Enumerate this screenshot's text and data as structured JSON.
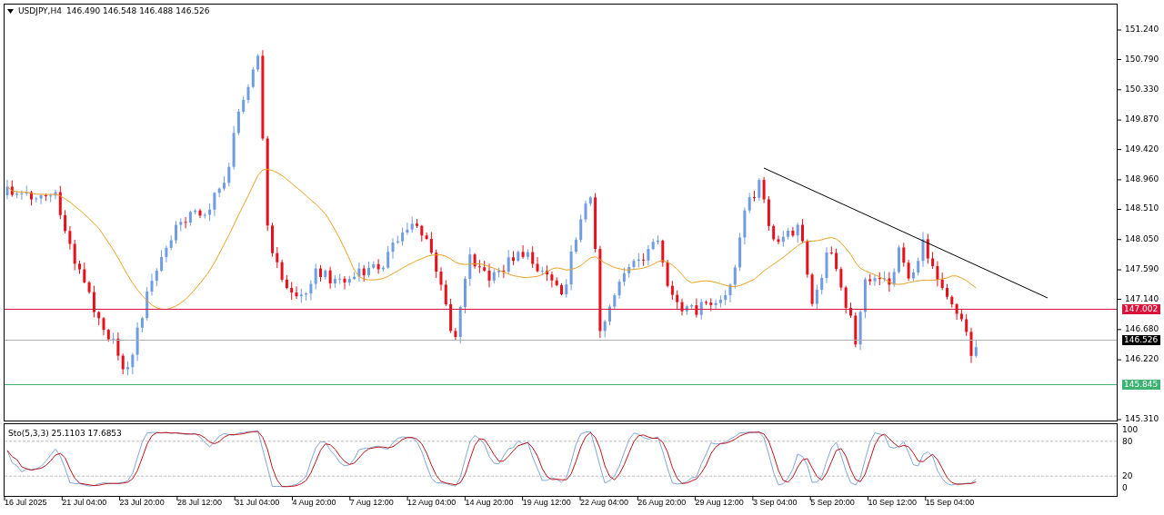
{
  "chart_header": {
    "symbol": "USDJPY,H4",
    "quotes": "146.490 146.548 146.488 146.526"
  },
  "price_axis": {
    "ticks": [
      "151.240",
      "150.790",
      "150.330",
      "149.870",
      "149.420",
      "148.960",
      "148.510",
      "148.050",
      "147.590",
      "147.140",
      "146.680",
      "146.220",
      "145.310"
    ]
  },
  "price_markers": [
    {
      "kind": "resistance",
      "label": "147.002",
      "color": "#dc143c"
    },
    {
      "kind": "current",
      "label": "146.526",
      "color": "#000000"
    },
    {
      "kind": "support",
      "label": "145.845",
      "color": "#3cb371"
    }
  ],
  "indicator": {
    "label": "Sto(5,3,3) 25.1103 17.6853",
    "levels": [
      "100",
      "80",
      "20",
      "0"
    ]
  },
  "time_axis": {
    "labels": [
      "16 Jul 2025",
      "21 Jul 04:00",
      "23 Jul 20:00",
      "28 Jul 12:00",
      "31 Jul 04:00",
      "4 Aug 20:00",
      "7 Aug 12:00",
      "12 Aug 04:00",
      "14 Aug 20:00",
      "19 Aug 12:00",
      "22 Aug 04:00",
      "26 Aug 20:00",
      "29 Aug 12:00",
      "3 Sep 04:00",
      "5 Sep 20:00",
      "10 Sep 12:00",
      "15 Sep 04:00"
    ]
  }
}
